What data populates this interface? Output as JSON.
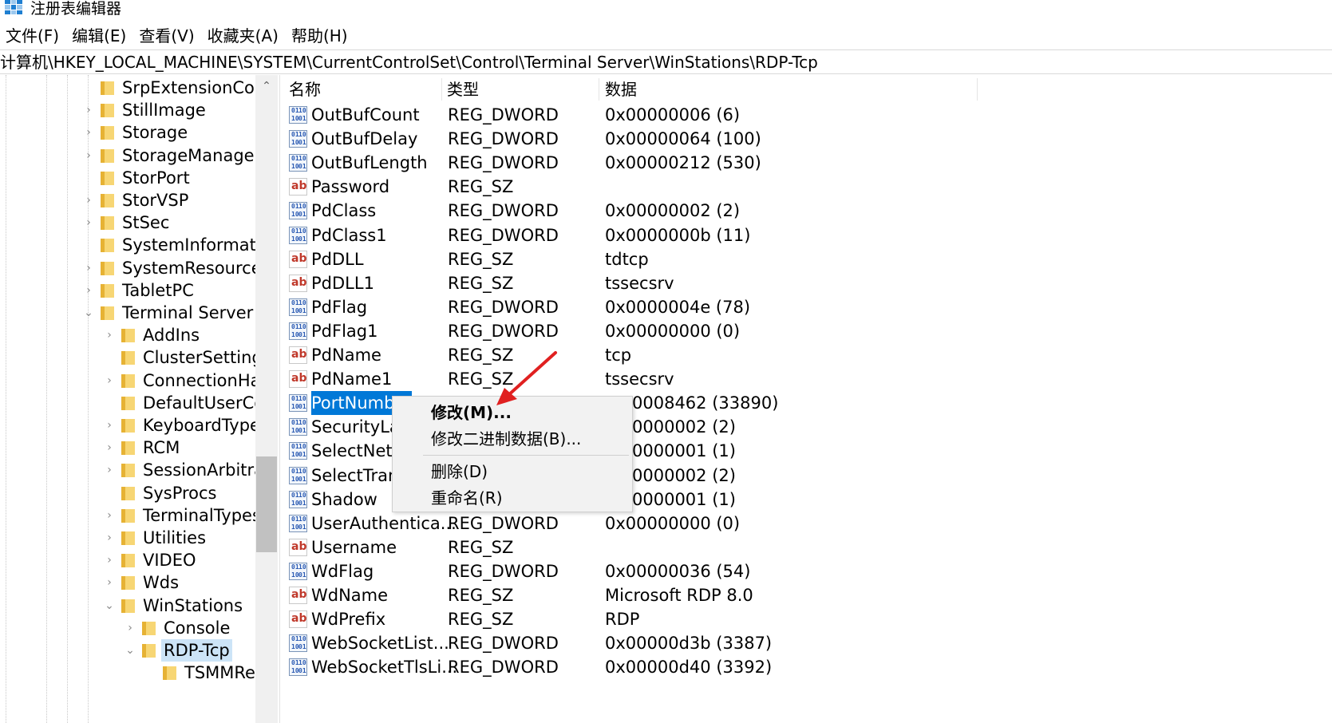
{
  "window": {
    "title": "注册表编辑器"
  },
  "menu": [
    "文件(F)",
    "编辑(E)",
    "查看(V)",
    "收藏夹(A)",
    "帮助(H)"
  ],
  "address": "计算机\\HKEY_LOCAL_MACHINE\\SYSTEM\\CurrentControlSet\\Control\\Terminal Server\\WinStations\\RDP-Tcp",
  "tree": [
    {
      "label": "SrpExtensionConf",
      "expander": ""
    },
    {
      "label": "StillImage",
      "expander": "›"
    },
    {
      "label": "Storage",
      "expander": "›"
    },
    {
      "label": "StorageManagem",
      "expander": "›"
    },
    {
      "label": "StorPort",
      "expander": ""
    },
    {
      "label": "StorVSP",
      "expander": "›"
    },
    {
      "label": "StSec",
      "expander": "›"
    },
    {
      "label": "SystemInformatio",
      "expander": ""
    },
    {
      "label": "SystemResources",
      "expander": "›"
    },
    {
      "label": "TabletPC",
      "expander": "›"
    },
    {
      "label": "Terminal Server",
      "expander": "⌄"
    },
    {
      "label": "AddIns",
      "expander": "›"
    },
    {
      "label": "ClusterSettings",
      "expander": ""
    },
    {
      "label": "ConnectionHar",
      "expander": "›"
    },
    {
      "label": "DefaultUserCo",
      "expander": ""
    },
    {
      "label": "KeyboardType",
      "expander": "›"
    },
    {
      "label": "RCM",
      "expander": "›"
    },
    {
      "label": "SessionArbitrat",
      "expander": "›"
    },
    {
      "label": "SysProcs",
      "expander": ""
    },
    {
      "label": "TerminalTypes",
      "expander": "›"
    },
    {
      "label": "Utilities",
      "expander": "›"
    },
    {
      "label": "VIDEO",
      "expander": "›"
    },
    {
      "label": "Wds",
      "expander": "›"
    },
    {
      "label": "WinStations",
      "expander": "⌄"
    },
    {
      "label": "Console",
      "expander": "›"
    },
    {
      "label": "RDP-Tcp",
      "expander": "⌄"
    },
    {
      "label": "TSMMRe",
      "expander": ""
    }
  ],
  "columns": {
    "name": "名称",
    "type": "类型",
    "data": "数据"
  },
  "values": [
    {
      "name": "OutBufCount",
      "type": "REG_DWORD",
      "data": "0x00000006 (6)",
      "icon": "binary-value-icon"
    },
    {
      "name": "OutBufDelay",
      "type": "REG_DWORD",
      "data": "0x00000064 (100)",
      "icon": "binary-value-icon"
    },
    {
      "name": "OutBufLength",
      "type": "REG_DWORD",
      "data": "0x00000212 (530)",
      "icon": "binary-value-icon"
    },
    {
      "name": "Password",
      "type": "REG_SZ",
      "data": "",
      "icon": "string-value-icon"
    },
    {
      "name": "PdClass",
      "type": "REG_DWORD",
      "data": "0x00000002 (2)",
      "icon": "binary-value-icon"
    },
    {
      "name": "PdClass1",
      "type": "REG_DWORD",
      "data": "0x0000000b (11)",
      "icon": "binary-value-icon"
    },
    {
      "name": "PdDLL",
      "type": "REG_SZ",
      "data": "tdtcp",
      "icon": "string-value-icon"
    },
    {
      "name": "PdDLL1",
      "type": "REG_SZ",
      "data": "tssecsrv",
      "icon": "string-value-icon"
    },
    {
      "name": "PdFlag",
      "type": "REG_DWORD",
      "data": "0x0000004e (78)",
      "icon": "binary-value-icon"
    },
    {
      "name": "PdFlag1",
      "type": "REG_DWORD",
      "data": "0x00000000 (0)",
      "icon": "binary-value-icon"
    },
    {
      "name": "PdName",
      "type": "REG_SZ",
      "data": "tcp",
      "icon": "string-value-icon"
    },
    {
      "name": "PdName1",
      "type": "REG_SZ",
      "data": "tssecsrv",
      "icon": "string-value-icon"
    },
    {
      "name": "PortNumb",
      "type": "",
      "data": "0008462 (33890)",
      "icon": "binary-value-icon"
    },
    {
      "name": "SecurityLay",
      "type": "",
      "data": "0000002 (2)",
      "icon": "binary-value-icon"
    },
    {
      "name": "SelectNetw",
      "type": "",
      "data": "0000001 (1)",
      "icon": "binary-value-icon"
    },
    {
      "name": "SelectTran",
      "type": "",
      "data": "0000002 (2)",
      "icon": "binary-value-icon"
    },
    {
      "name": "Shadow",
      "type": "",
      "data": "0000001 (1)",
      "icon": "binary-value-icon"
    },
    {
      "name": "UserAuthentica...",
      "type": "REG_DWORD",
      "data": "0x00000000 (0)",
      "icon": "binary-value-icon"
    },
    {
      "name": "Username",
      "type": "REG_SZ",
      "data": "",
      "icon": "string-value-icon"
    },
    {
      "name": "WdFlag",
      "type": "REG_DWORD",
      "data": "0x00000036 (54)",
      "icon": "binary-value-icon"
    },
    {
      "name": "WdName",
      "type": "REG_SZ",
      "data": "Microsoft RDP 8.0",
      "icon": "string-value-icon"
    },
    {
      "name": "WdPrefix",
      "type": "REG_SZ",
      "data": "RDP",
      "icon": "string-value-icon"
    },
    {
      "name": "WebSocketList...",
      "type": "REG_DWORD",
      "data": "0x00000d3b (3387)",
      "icon": "binary-value-icon"
    },
    {
      "name": "WebSocketTlsLi...",
      "type": "REG_DWORD",
      "data": "0x00000d40 (3392)",
      "icon": "binary-value-icon"
    }
  ],
  "context_menu": {
    "modify": "修改(M)...",
    "modify_binary": "修改二进制数据(B)...",
    "delete": "删除(D)",
    "rename": "重命名(R)"
  },
  "colors": {
    "selection": "#0078d7",
    "arrow": "#e02020"
  }
}
